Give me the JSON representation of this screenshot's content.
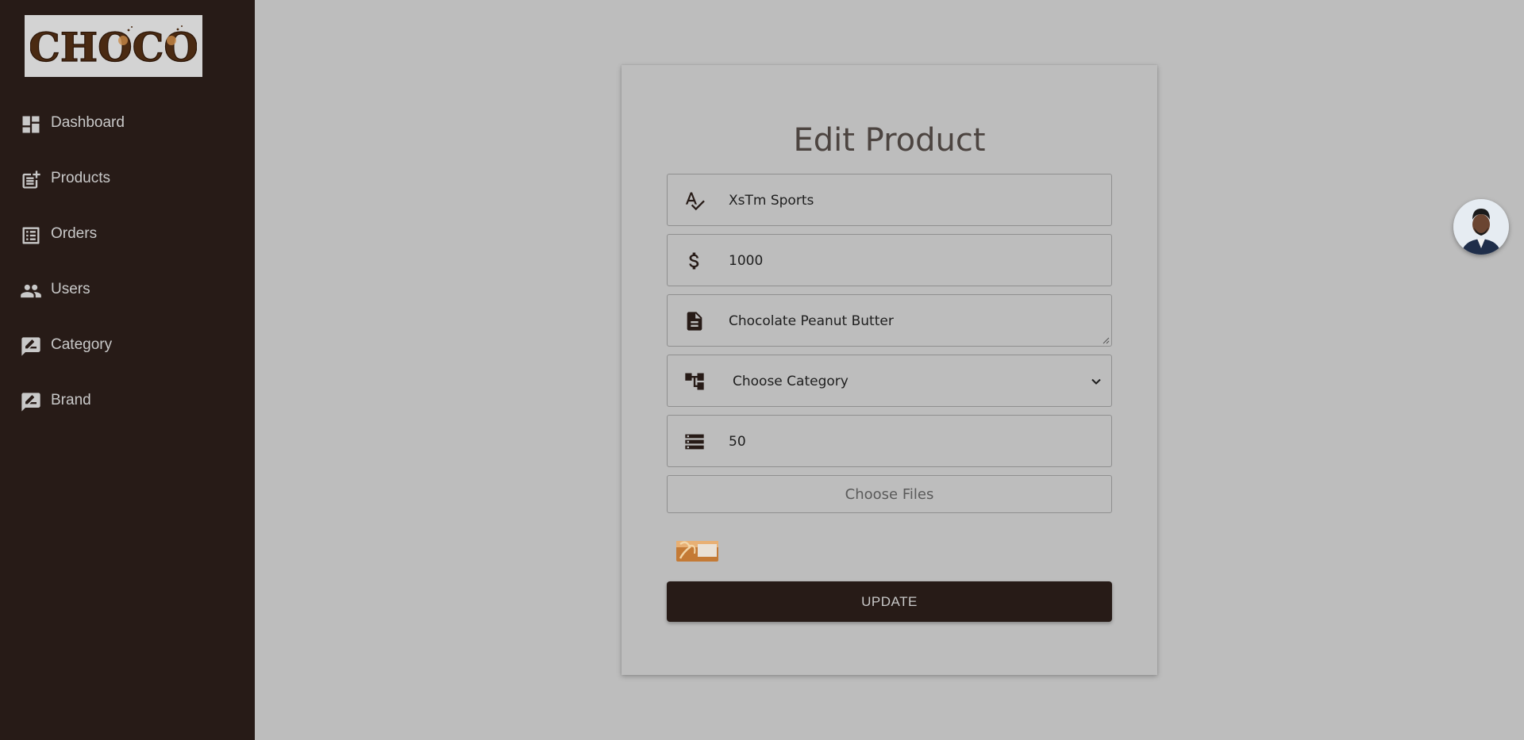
{
  "brand": {
    "logo_text": "CHOCO",
    "logo_color": "#4a2a12"
  },
  "sidebar": {
    "items": [
      {
        "label": "Dashboard",
        "icon": "dashboard-icon"
      },
      {
        "label": "Products",
        "icon": "post-add-icon"
      },
      {
        "label": "Orders",
        "icon": "list-alt-icon"
      },
      {
        "label": "Users",
        "icon": "people-icon"
      },
      {
        "label": "Category",
        "icon": "rate-review-icon"
      },
      {
        "label": "Brand",
        "icon": "rate-review-icon"
      }
    ]
  },
  "form": {
    "title": "Edit Product",
    "name_value": "XsTm Sports",
    "price_value": "1000",
    "description_value": "Chocolate Peanut Butter",
    "category_selected": "Choose Category",
    "stock_value": "50",
    "file_button_label": "Choose Files",
    "submit_label": "UPDATE"
  },
  "colors": {
    "sidebar_bg": "#271b17",
    "page_bg": "#bdbdbd",
    "button_bg": "#271b17"
  }
}
